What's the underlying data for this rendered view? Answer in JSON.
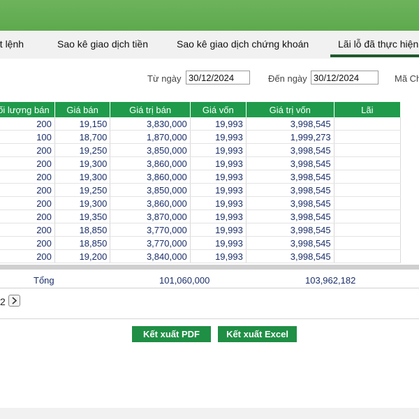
{
  "tabs": [
    {
      "label": "ặt lệnh"
    },
    {
      "label": "Sao kê giao dịch tiền"
    },
    {
      "label": "Sao kê giao dịch chứng khoán"
    },
    {
      "label": "Lãi lỗ đã thực hiện"
    }
  ],
  "filters": {
    "from_label": "Từ ngày",
    "from_value": "30/12/2024",
    "to_label": "Đến ngày",
    "to_value": "30/12/2024",
    "code_label": "Mã Ch"
  },
  "table": {
    "headers": [
      "Khối lượng bán",
      "Giá bán",
      "Giá trị bán",
      "Giá vốn",
      "Giá trị vốn",
      "Lãi"
    ],
    "rows": [
      [
        "200",
        "19,150",
        "3,830,000",
        "19,993",
        "3,998,545",
        ""
      ],
      [
        "100",
        "18,700",
        "1,870,000",
        "19,993",
        "1,999,273",
        ""
      ],
      [
        "200",
        "19,250",
        "3,850,000",
        "19,993",
        "3,998,545",
        ""
      ],
      [
        "200",
        "19,300",
        "3,860,000",
        "19,993",
        "3,998,545",
        ""
      ],
      [
        "200",
        "19,300",
        "3,860,000",
        "19,993",
        "3,998,545",
        ""
      ],
      [
        "200",
        "19,250",
        "3,850,000",
        "19,993",
        "3,998,545",
        ""
      ],
      [
        "200",
        "19,300",
        "3,860,000",
        "19,993",
        "3,998,545",
        ""
      ],
      [
        "200",
        "19,350",
        "3,870,000",
        "19,993",
        "3,998,545",
        ""
      ],
      [
        "200",
        "18,850",
        "3,770,000",
        "19,993",
        "3,998,545",
        ""
      ],
      [
        "200",
        "18,850",
        "3,770,000",
        "19,993",
        "3,998,545",
        ""
      ],
      [
        "200",
        "19,200",
        "3,840,000",
        "19,993",
        "3,998,545",
        ""
      ]
    ]
  },
  "totals": {
    "label": "Tổng",
    "sell_value": "101,060,000",
    "cost_value": "103,962,182"
  },
  "pager": {
    "current": "2",
    "next_icon": "chevron-right-icon"
  },
  "buttons": {
    "pdf": "Kết xuất PDF",
    "excel": "Kết xuất Excel"
  },
  "colors": {
    "header_green": "#1f9b4b",
    "topbar_green": "#5ea94d",
    "active_tab": "#1d5a2b",
    "value_blue": "#1a2f6b"
  }
}
